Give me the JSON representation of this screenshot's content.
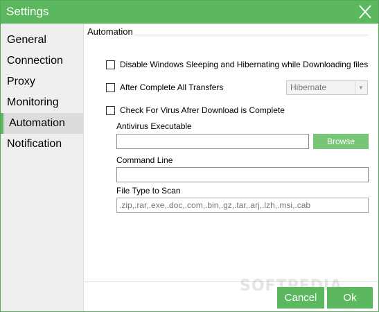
{
  "window": {
    "title": "Settings",
    "accent_color": "#5cb85f",
    "close_icon": "close-icon"
  },
  "sidebar": {
    "items": [
      {
        "label": "General",
        "active": false
      },
      {
        "label": "Connection",
        "active": false
      },
      {
        "label": "Proxy",
        "active": false
      },
      {
        "label": "Monitoring",
        "active": false
      },
      {
        "label": "Automation",
        "active": true
      },
      {
        "label": "Notification",
        "active": false
      }
    ]
  },
  "automation": {
    "section_title": "Automation",
    "disable_sleep": {
      "label": "Disable Windows Sleeping and Hibernating while Downloading files",
      "checked": false
    },
    "after_complete": {
      "label": "After Complete All Transfers",
      "checked": false,
      "selected_option": "Hibernate"
    },
    "virus_check": {
      "label": "Check For Virus Afrer Download is Complete",
      "checked": false
    },
    "antivirus_executable": {
      "label": "Antivirus Executable",
      "value": "",
      "browse_label": "Browse"
    },
    "command_line": {
      "label": "Command Line",
      "value": ""
    },
    "file_types": {
      "label": "File Type to Scan",
      "value": ".zip,.rar,.exe,.doc,.com,.bin,.gz,.tar,.arj,.lzh,.msi,.cab"
    }
  },
  "footer": {
    "cancel_label": "Cancel",
    "ok_label": "Ok"
  },
  "watermark": "SOFTPEDIA"
}
